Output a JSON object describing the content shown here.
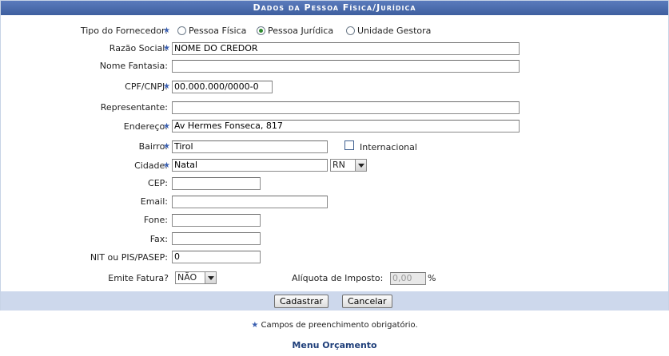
{
  "header": {
    "title": "Dados da Pessoa Física/Jurídica"
  },
  "form": {
    "tipo_label": "Tipo do Fornecedor:",
    "tipo_options": [
      "Pessoa Física",
      "Pessoa Jurídica",
      "Unidade Gestora"
    ],
    "tipo_selected": "Pessoa Jurídica",
    "razao_label": "Razão Social:",
    "razao_value": "NOME DO CREDOR",
    "fantasia_label": "Nome Fantasia:",
    "fantasia_value": "",
    "cpf_label": "CPF/CNPJ:",
    "cpf_value": "00.000.000/0000-0",
    "representante_label": "Representante:",
    "representante_value": "",
    "endereco_label": "Endereço:",
    "endereco_value": "Av Hermes Fonseca, 817",
    "bairro_label": "Bairro:",
    "bairro_value": "Tirol",
    "internacional_label": "Internacional",
    "cidade_label": "Cidade:",
    "cidade_value": "Natal",
    "uf_value": "RN",
    "cep_label": "CEP:",
    "cep_value": "",
    "email_label": "Email:",
    "email_value": "",
    "fone_label": "Fone:",
    "fone_value": "",
    "fax_label": "Fax:",
    "fax_value": "",
    "nit_label": "NIT ou PIS/PASEP:",
    "nit_value": "0",
    "fatura_label": "Emite Fatura?",
    "fatura_value": "NÃO",
    "aliquota_label": "Alíquota de Imposto:",
    "aliquota_value": "0,00",
    "aliquota_unit": "%"
  },
  "buttons": {
    "cadastrar": "Cadastrar",
    "cancelar": "Cancelar"
  },
  "footer": {
    "required_note": "Campos de preenchimento obrigatório.",
    "menu_link": "Menu Orçamento"
  },
  "colors": {
    "header": "#4a6aab",
    "button_bar": "#cdd8ec",
    "required_star": "#3a5fb0"
  }
}
